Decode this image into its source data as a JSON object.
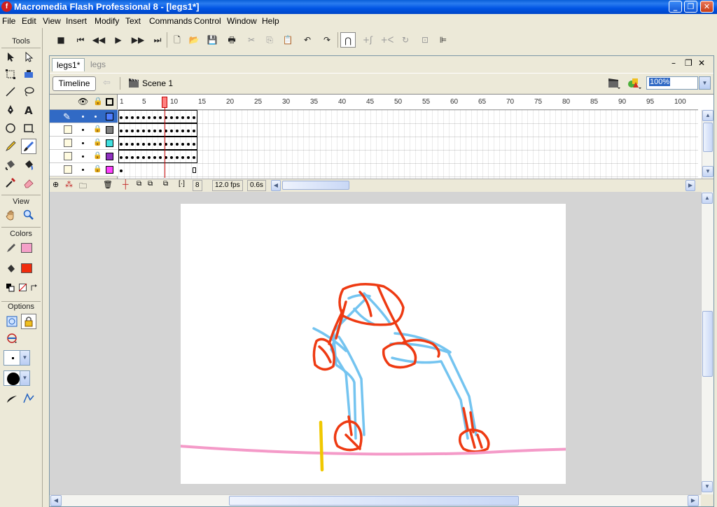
{
  "window": {
    "title": "Macromedia Flash Professional 8 - [legs1*]",
    "app_icon": "flash-app-icon",
    "minimize": "_",
    "maximize": "❐",
    "close": "✕"
  },
  "menu": [
    "File",
    "Edit",
    "View",
    "Insert",
    "Modify",
    "Text",
    "Commands",
    "Control",
    "Window",
    "Help"
  ],
  "tools_panel": {
    "title": "Tools",
    "view_label": "View",
    "colors_label": "Colors",
    "options_label": "Options",
    "stroke_color": "#f4a0c8",
    "fill_color": "#f02c0c"
  },
  "document": {
    "tabs": [
      {
        "label": "legs1*",
        "active": true
      },
      {
        "label": "legs",
        "active": false
      }
    ],
    "timeline_button": "Timeline",
    "scene_label": "Scene 1",
    "zoom": "100%"
  },
  "timeline": {
    "frame_numbers": [
      "1",
      "5",
      "10",
      "15",
      "20",
      "25",
      "30",
      "35",
      "40",
      "45",
      "50",
      "55",
      "60",
      "65",
      "70",
      "75",
      "80",
      "85",
      "90",
      "95",
      "100"
    ],
    "layer_colors": [
      "#4f7fff",
      "#808080",
      "#40e0e0",
      "#9030c0",
      "#ff40ff"
    ],
    "current_frame": "8",
    "fps": "12.0 fps",
    "elapsed": "0.6s"
  },
  "stage": {
    "ground_color": "#f49ac8",
    "red_color": "#ee3a12",
    "blue_color": "#74c4f0",
    "marker_color": "#f0c800"
  }
}
